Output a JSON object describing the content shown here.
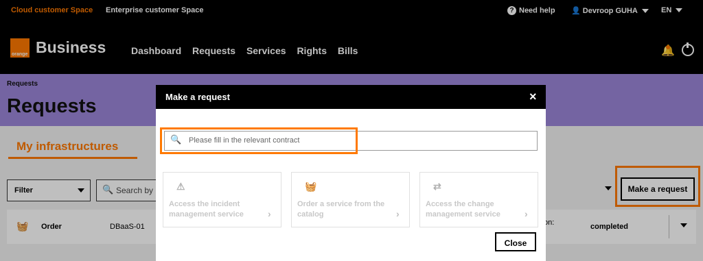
{
  "topbar": {
    "tab_cloud": "Cloud customer Space",
    "tab_enterprise": "Enterprise customer Space",
    "help": "Need help",
    "user": "Devroop GUHA",
    "lang": "EN"
  },
  "navbar": {
    "logo_text": "orange",
    "brand": "Business",
    "items": [
      "Dashboard",
      "Requests",
      "Services",
      "Rights",
      "Bills"
    ]
  },
  "hero": {
    "breadcrumb": "Requests",
    "title": "Requests"
  },
  "content": {
    "section": "My infrastructures",
    "filter": "Filter",
    "search_placeholder": "Search by",
    "make_request": "Make a request",
    "row": {
      "type": "Order",
      "ref": "DBaaS-01",
      "partial": "on:",
      "status": "completed"
    }
  },
  "modal": {
    "title": "Make a request",
    "close_icon": "×",
    "search_placeholder": "Please fill in the relevant contract",
    "cards": [
      {
        "icon": "warning-icon",
        "label": "Access the incident management service"
      },
      {
        "icon": "basket-icon",
        "label": "Order a service from the catalog"
      },
      {
        "icon": "arrows-icon",
        "label": "Access the change management service"
      }
    ],
    "close_button": "Close"
  },
  "colors": {
    "accent": "#ff7900",
    "hero": "#9b86d8"
  }
}
